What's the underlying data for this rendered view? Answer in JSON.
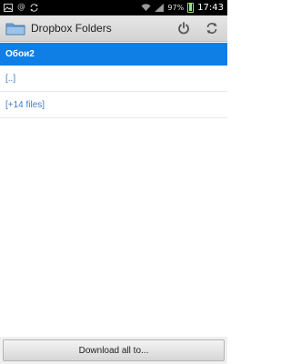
{
  "status_bar": {
    "clock": "17:43",
    "battery_percent": "97%",
    "left_icons": [
      "gallery-icon",
      "at-icon",
      "sync-icon"
    ],
    "right_icons": [
      "wifi-icon",
      "signal-icon",
      "battery-icon"
    ]
  },
  "action_bar": {
    "title": "Dropbox Folders",
    "icons": [
      "folder-icon",
      "power-icon",
      "refresh-icon"
    ]
  },
  "list": {
    "items": [
      {
        "label": "Обои2",
        "selected": true
      },
      {
        "label": "[..]"
      },
      {
        "label": "[+14 files]"
      }
    ]
  },
  "footer": {
    "download_label": "Download all to..."
  },
  "colors": {
    "selected_row": "#0f7fe6",
    "link_text": "#3d7ec8",
    "status_bar": "#000000"
  }
}
